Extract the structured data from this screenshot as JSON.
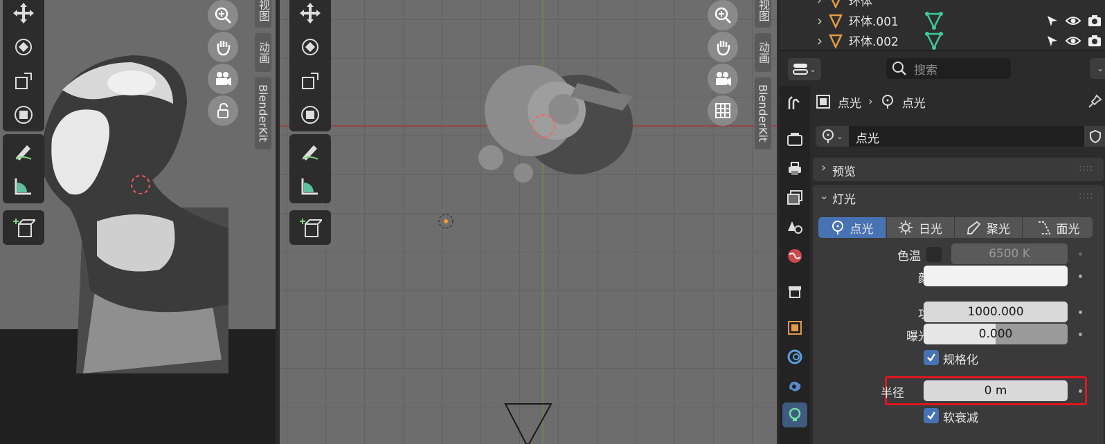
{
  "viewport_left": {
    "side_tabs": [
      "视图",
      "动画",
      "BlenderKit"
    ]
  },
  "viewport_center": {
    "side_tabs": [
      "视图",
      "动画",
      "BlenderKit"
    ]
  },
  "outliner": {
    "rows": [
      {
        "name": "环体"
      },
      {
        "name": "环体.001"
      },
      {
        "name": "环体.002"
      }
    ]
  },
  "properties": {
    "search_placeholder": "搜索",
    "breadcrumb": {
      "object": "点光",
      "data": "点光"
    },
    "datablock_name": "点光",
    "panels": {
      "preview": "预览",
      "light": "灯光"
    },
    "light_types": [
      {
        "label": "点光",
        "active": true
      },
      {
        "label": "日光",
        "active": false
      },
      {
        "label": "聚光",
        "active": false
      },
      {
        "label": "面光",
        "active": false
      }
    ],
    "fields": {
      "temperature_label": "色温",
      "temperature_value": "6500 K",
      "color_label": "颜色",
      "power_label": "功率",
      "power_value": "1000.000",
      "exposure_label": "曝光度",
      "exposure_value": "0.000",
      "normalize_label": "规格化",
      "radius_label": "半径",
      "radius_value": "0 m",
      "soft_falloff_label": "软衰减"
    },
    "highlight_color": "#e0161c",
    "accent_color": "#4772b3"
  }
}
